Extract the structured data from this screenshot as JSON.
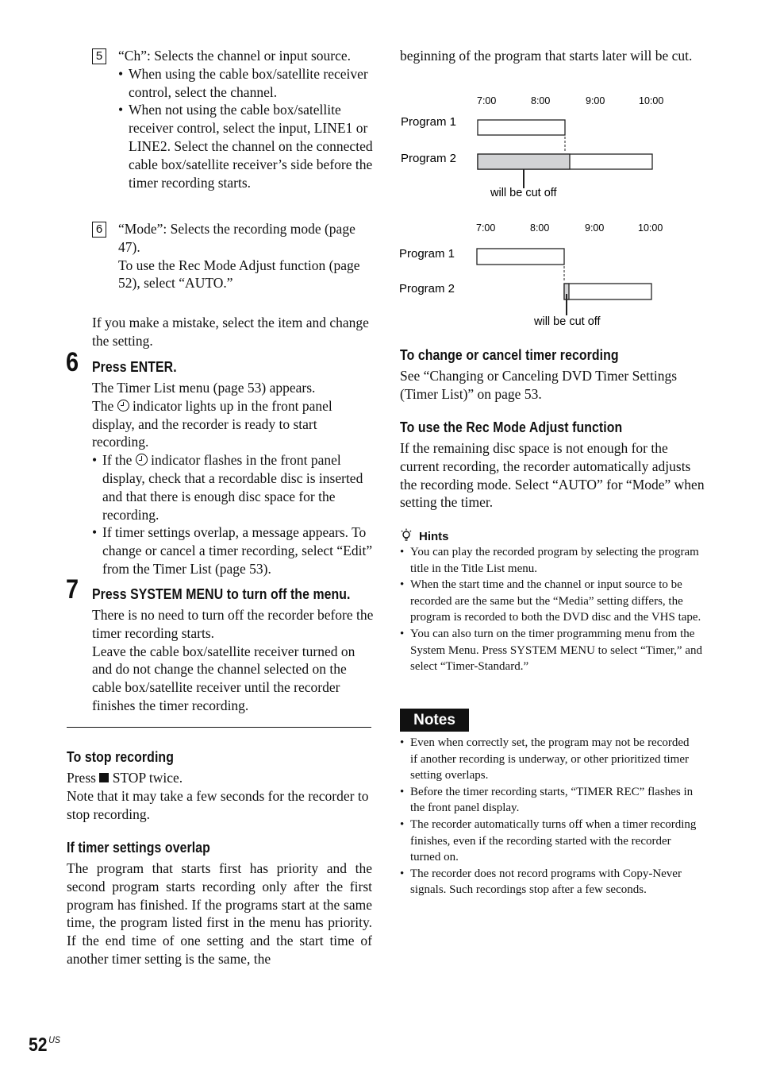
{
  "left_column": {
    "item5": {
      "number": "5",
      "text": "“Ch”: Selects the channel or input source.",
      "bullets": [
        "When using the cable box/satellite receiver control, select the channel.",
        "When not using the cable box/satellite receiver control, select the input, LINE1 or LINE2. Select the channel on the connected cable box/satellite receiver’s side before the timer recording starts."
      ]
    },
    "item6": {
      "number": "6",
      "text": "“Mode”: Selects the recording mode (page 47).",
      "subtext": "To use the Rec Mode Adjust function (page 52), select “AUTO.”"
    },
    "mistake_text": "If you make a mistake, select the item and change the setting.",
    "step6": {
      "number": "6",
      "title": "Press ENTER.",
      "line1": "The Timer List menu (page 53) appears.",
      "line2_before_icon": "The",
      "line2_after_icon": "indicator lights up in the front panel display, and the recorder is ready to start recording.",
      "bullet1_before_icon": "If the",
      "bullet1_after_icon": "indicator flashes in the front panel display, check that a recordable disc is inserted and that there is enough disc space for the recording.",
      "bullet2": "If timer settings overlap, a message appears. To change or cancel a timer recording, select “Edit” from the Timer List (page 53)."
    },
    "step7": {
      "number": "7",
      "title": "Press SYSTEM MENU to turn off the menu.",
      "para1": "There is no need to turn off the recorder before the timer recording starts.",
      "para2": "Leave the cable box/satellite receiver turned on and do not change the channel selected on the cable box/satellite receiver until the recorder finishes the timer recording."
    },
    "stop_recording": {
      "heading": "To stop recording",
      "press_before": "Press",
      "press_after": "STOP twice.",
      "note": "Note that it may take a few seconds for the recorder to stop recording."
    },
    "overlap": {
      "heading": "If timer settings overlap",
      "text": "The program that starts first has priority and the second program starts recording only after the first program has finished. If the programs start at the same time, the program listed first in the menu has priority. If the end time of one setting and the start time of another timer setting is the same, the"
    }
  },
  "right_column": {
    "continued_text": "beginning of the program that starts later will be cut.",
    "diagram1": {
      "times": [
        "7:00",
        "8:00",
        "9:00",
        "10:00"
      ],
      "program1_label": "Program 1",
      "program2_label": "Program 2",
      "cutoff_label": "will be cut off",
      "program1": {
        "start": "7:00",
        "end": "8:30"
      },
      "program2": {
        "start": "7:00",
        "end": "10:00",
        "cut_until": "8:30"
      }
    },
    "diagram2": {
      "times": [
        "7:00",
        "8:00",
        "9:00",
        "10:00"
      ],
      "program1_label": "Program 1",
      "program2_label": "Program 2",
      "cutoff_label": "will be cut off",
      "program1": {
        "start": "7:00",
        "end": "8:30"
      },
      "program2": {
        "start": "8:30",
        "end": "10:00",
        "cut_until": "8:35"
      }
    },
    "change_cancel": {
      "heading": "To change or cancel timer recording",
      "text": "See “Changing or Canceling DVD Timer Settings (Timer List)”  on page 53."
    },
    "rec_mode": {
      "heading": "To use the Rec Mode Adjust function",
      "text": "If the remaining disc space is not enough for the current recording, the recorder automatically adjusts the recording mode. Select “AUTO” for “Mode” when setting the timer."
    },
    "hints": {
      "title": "Hints",
      "items": [
        "You can play the recorded program by selecting the program title in the Title List menu.",
        "When the start time and the channel or input source to be recorded are the same but the “Media” setting differs, the program is recorded to both the DVD disc and the VHS tape.",
        "You can also turn on the timer programming menu from the System Menu. Press SYSTEM MENU to select “Timer,” and select “Timer-Standard.”"
      ]
    },
    "notes": {
      "title": "Notes",
      "items": [
        "Even when correctly set, the program may not be recorded if another recording is underway, or other prioritized timer setting overlaps.",
        "Before the timer recording starts, “TIMER REC” flashes in the front panel display.",
        "The recorder automatically turns off when a timer recording finishes, even if the recording started with the recorder turned on.",
        "The recorder does not record programs with Copy-Never signals. Such recordings stop after a few seconds."
      ]
    }
  },
  "footer": {
    "page_number": "52",
    "region": "US"
  }
}
